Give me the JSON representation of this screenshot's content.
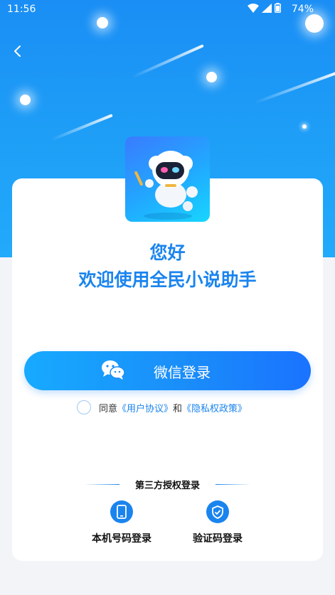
{
  "status_bar": {
    "time": "11:56",
    "battery": "74%"
  },
  "greeting": {
    "line1": "您好",
    "line2": "欢迎使用全民小说助手"
  },
  "wechat_login": {
    "label": "微信登录"
  },
  "agreement": {
    "prefix": "同意",
    "user_agreement": "《用户协议》",
    "and": "和",
    "privacy_policy": "《隐私权政策》"
  },
  "third_party": {
    "title": "第三方授权登录",
    "options": [
      {
        "label": "本机号码登录",
        "icon": "phone-icon"
      },
      {
        "label": "验证码登录",
        "icon": "shield-check-icon"
      }
    ]
  },
  "colors": {
    "primary": "#1a84ee",
    "hero": "#1e9ff7",
    "page_bg": "#f3f4f8"
  }
}
